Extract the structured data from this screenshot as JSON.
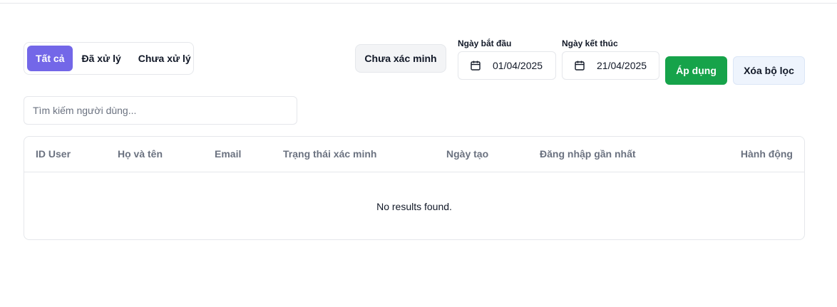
{
  "tabs": [
    {
      "label": "Tất cả",
      "active": true
    },
    {
      "label": "Đã xử lý",
      "active": false
    },
    {
      "label": "Chưa xử lý",
      "active": false
    }
  ],
  "filters": {
    "unverified_label": "Chưa xác minh",
    "start_date_label": "Ngày bắt đầu",
    "start_date_value": "01/04/2025",
    "end_date_label": "Ngày kết thúc",
    "end_date_value": "21/04/2025",
    "apply_label": "Áp dụng",
    "clear_label": "Xóa bộ lọc",
    "calendar_icon": "calendar-icon"
  },
  "search": {
    "placeholder": "Tìm kiếm người dùng..."
  },
  "table": {
    "columns": [
      "ID User",
      "Họ và tên",
      "Email",
      "Trạng thái xác minh",
      "Ngày tạo",
      "Đăng nhập gần nhất",
      "Hành động"
    ],
    "empty_text": "No results found."
  },
  "colors": {
    "tab_active": "#7367e8",
    "apply": "#16a34a",
    "clear_bg": "#eef4fd"
  }
}
